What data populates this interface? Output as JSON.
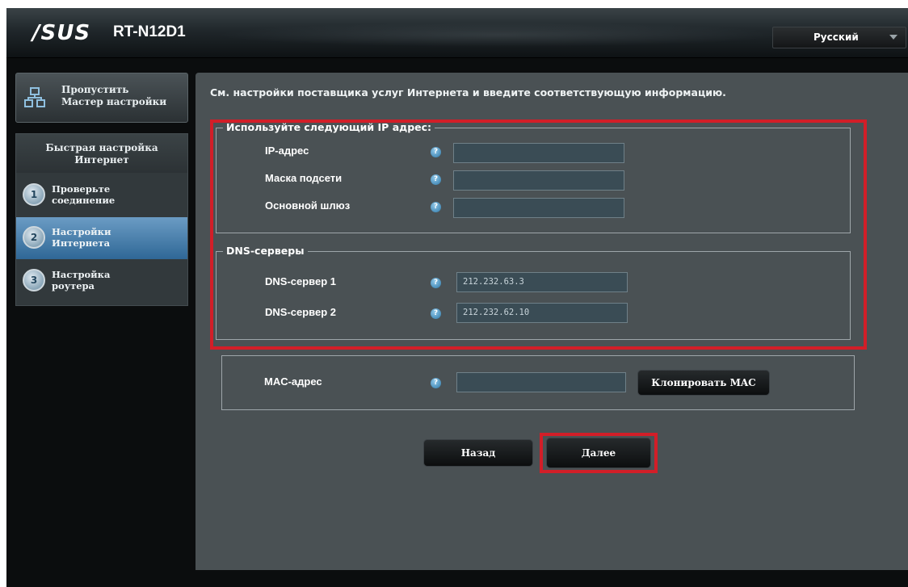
{
  "header": {
    "brand": "/SUS",
    "model": "RT-N12D1",
    "language": "Русский"
  },
  "sidebar": {
    "skip_line1": "Пропустить",
    "skip_line2": "Мастер настройки",
    "menu_title_line1": "Быстрая настройка",
    "menu_title_line2": "Интернет",
    "steps": [
      {
        "num": "1",
        "line1": "Проверьте",
        "line2": "соединение",
        "active": false
      },
      {
        "num": "2",
        "line1": "Настройки",
        "line2": "Интернета",
        "active": true
      },
      {
        "num": "3",
        "line1": "Настройка",
        "line2": "роутера",
        "active": false
      }
    ]
  },
  "main": {
    "instruction": "См. настройки поставщика услуг Интернета и введите соответствующую информацию.",
    "ip_group": {
      "legend": "Используйте следующий IP адрес:",
      "fields": [
        {
          "label": "IP-адрес",
          "value": ""
        },
        {
          "label": "Маска подсети",
          "value": ""
        },
        {
          "label": "Основной шлюз",
          "value": ""
        }
      ]
    },
    "dns_group": {
      "legend": "DNS-серверы",
      "fields": [
        {
          "label": "DNS-сервер 1",
          "value": "212.232.63.3"
        },
        {
          "label": "DNS-сервер 2",
          "value": "212.232.62.10"
        }
      ]
    },
    "mac": {
      "label": "MAC-адрес",
      "value": "",
      "clone_button": "Клонировать MAC"
    },
    "help_glyph": "?",
    "back_button": "Назад",
    "next_button": "Далее"
  },
  "colors": {
    "highlight": "#d21e28",
    "active_step": "#3f76a3",
    "panel": "#4a5154"
  }
}
